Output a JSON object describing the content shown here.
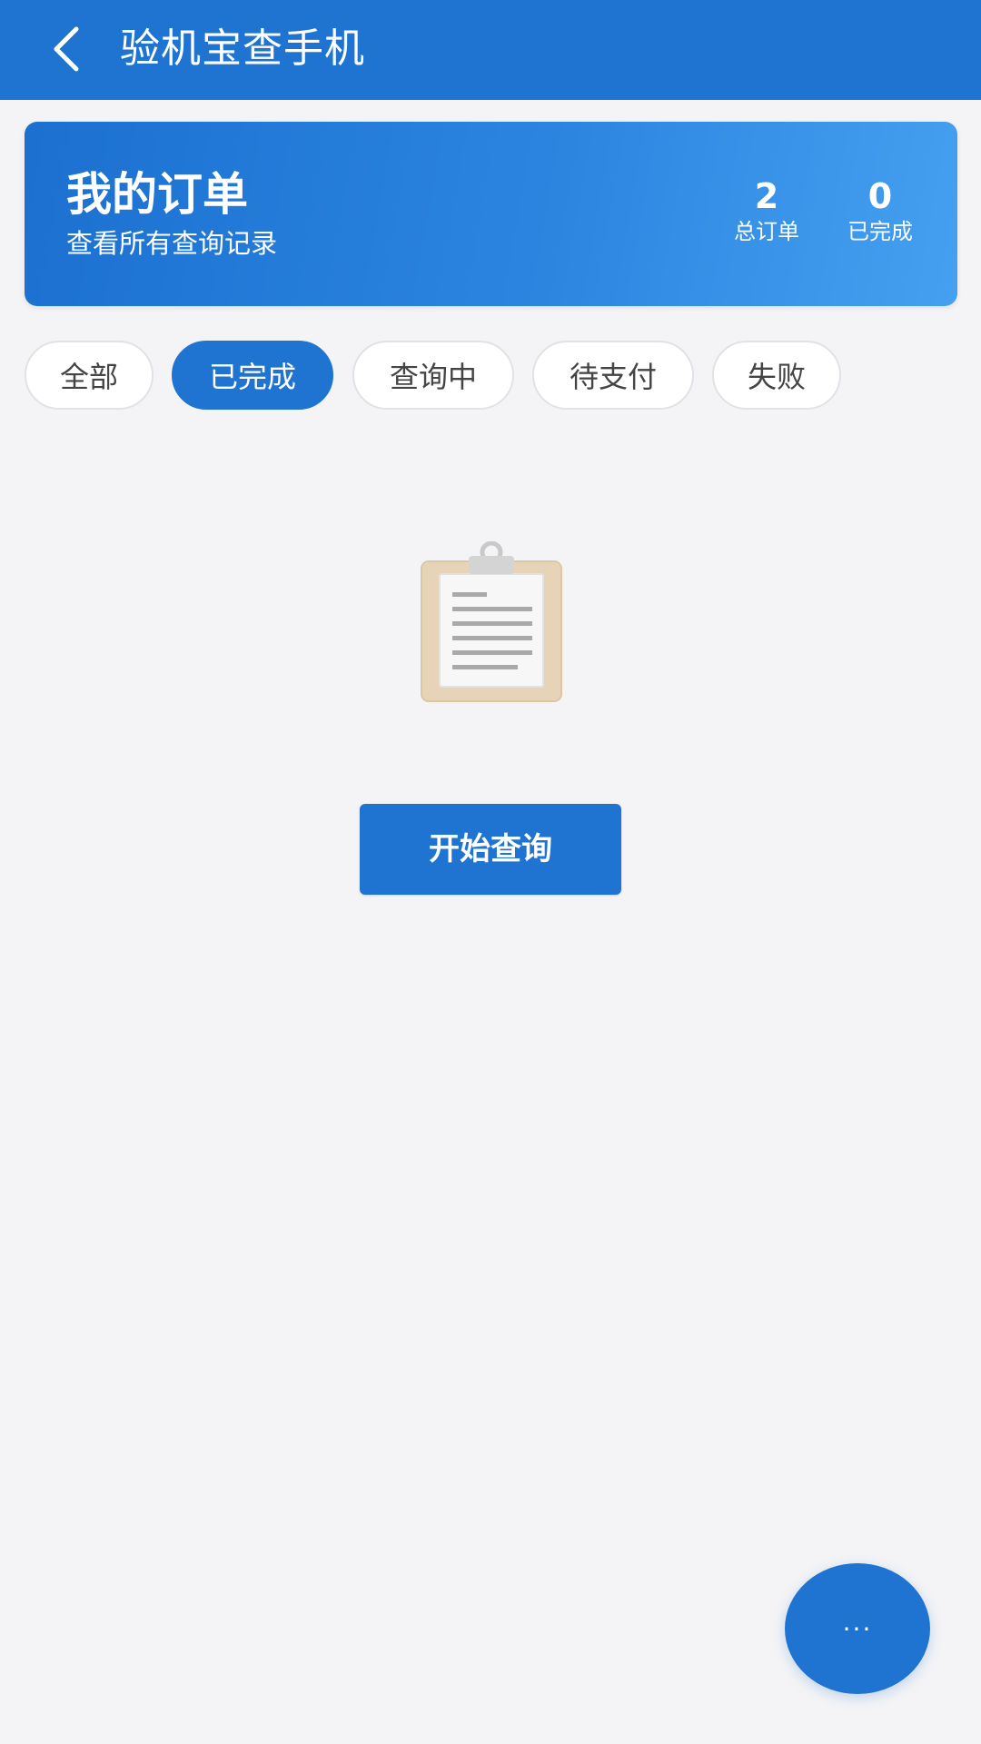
{
  "header": {
    "back_icon": "chevron-left-icon",
    "title": "验机宝查手机"
  },
  "summary": {
    "title": "我的订单",
    "subtitle": "查看所有查询记录",
    "stats": [
      {
        "value": "2",
        "label": "总订单"
      },
      {
        "value": "0",
        "label": "已完成"
      }
    ]
  },
  "filters": {
    "tabs": [
      "全部",
      "已完成",
      "查询中",
      "待支付",
      "失败"
    ],
    "active": "已完成"
  },
  "empty_state": {
    "icon": "clipboard-icon",
    "button_label": "开始查询"
  },
  "fab": {
    "icon": "more-dots-icon",
    "label": "···"
  },
  "colors": {
    "primary": "#1f74d2",
    "background": "#f4f4f6"
  }
}
